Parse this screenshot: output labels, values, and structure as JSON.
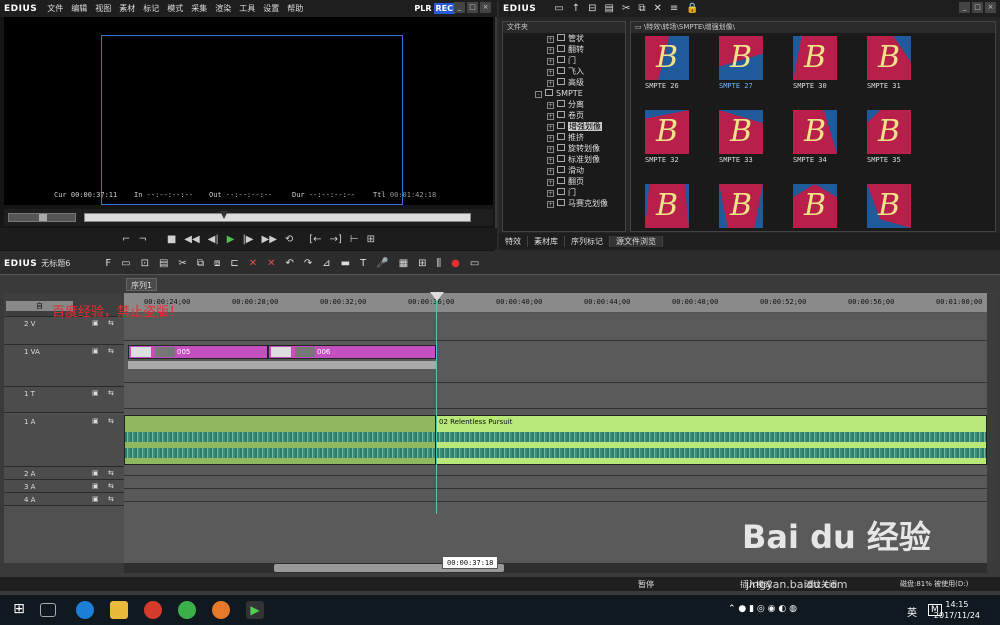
{
  "player": {
    "logo": "EDIUS",
    "menu": [
      "文件",
      "编辑",
      "视图",
      "素材",
      "标记",
      "模式",
      "采集",
      "渲染",
      "工具",
      "设置",
      "帮助"
    ],
    "plr": "PLR",
    "rec": "REC",
    "timecode": {
      "cur_label": "Cur",
      "cur": "00:00:37:11",
      "in_label": "In",
      "in": "--:--:--:--",
      "out_label": "Out",
      "out": "--:--:--:--",
      "dur_label": "Dur",
      "dur": "--:--:--:--",
      "ttl_label": "Ttl",
      "ttl": "00:01:42:18"
    },
    "scrub_position": 0.36
  },
  "bin": {
    "logo": "EDIUS",
    "tree_header": "文件夹",
    "path": "\\特效\\转场\\SMPTE\\增强划像\\",
    "tree": [
      {
        "label": "管状",
        "indent": 1,
        "box": "+"
      },
      {
        "label": "翻转",
        "indent": 1,
        "box": "+"
      },
      {
        "label": "门",
        "indent": 1,
        "box": "+"
      },
      {
        "label": "飞入",
        "indent": 1,
        "box": "+"
      },
      {
        "label": "高级",
        "indent": 1,
        "box": "+"
      },
      {
        "label": "SMPTE",
        "indent": 0,
        "box": "-"
      },
      {
        "label": "分离",
        "indent": 1,
        "box": "+"
      },
      {
        "label": "卷页",
        "indent": 1,
        "box": "+"
      },
      {
        "label": "增强划像",
        "indent": 1,
        "box": "+",
        "selected": true
      },
      {
        "label": "推挤",
        "indent": 1,
        "box": "+"
      },
      {
        "label": "旋转划像",
        "indent": 1,
        "box": "+"
      },
      {
        "label": "标准划像",
        "indent": 1,
        "box": "+"
      },
      {
        "label": "滑动",
        "indent": 1,
        "box": "+"
      },
      {
        "label": "翻页",
        "indent": 1,
        "box": "+"
      },
      {
        "label": "门",
        "indent": 1,
        "box": "+"
      },
      {
        "label": "马赛克划像",
        "indent": 1,
        "box": "+"
      }
    ],
    "thumbs": [
      {
        "label": "SMPTE  26",
        "selected": false
      },
      {
        "label": "SMPTE  27",
        "selected": true
      },
      {
        "label": "SMPTE  30",
        "selected": false
      },
      {
        "label": "SMPTE  31",
        "selected": false
      },
      {
        "label": "SMPTE  32",
        "selected": false
      },
      {
        "label": "SMPTE  33",
        "selected": false
      },
      {
        "label": "SMPTE  34",
        "selected": false
      },
      {
        "label": "SMPTE  35",
        "selected": false
      },
      {
        "label": "",
        "selected": false
      },
      {
        "label": "",
        "selected": false
      },
      {
        "label": "",
        "selected": false
      },
      {
        "label": "",
        "selected": false
      }
    ],
    "thumb_letter": "B",
    "tabs": [
      "特效",
      "素材库",
      "序列标记",
      "源文件浏览"
    ]
  },
  "timeline": {
    "logo": "EDIUS",
    "project": "无标题6",
    "sequence_tab": "序列1",
    "ruler": [
      "00:00:24;00",
      "00:00:28;00",
      "00:00:32;00",
      "00:00:36;00",
      "00:00:40;00",
      "00:00:44;00",
      "00:00:48;00",
      "00:00:52;00",
      "00:00:56;00",
      "00:01:00;00"
    ],
    "auto_label": "自",
    "tracks": [
      {
        "name": "2 V"
      },
      {
        "name": "1 VA"
      },
      {
        "name": "1 T"
      },
      {
        "name": "1 A"
      },
      {
        "name": "2 A"
      },
      {
        "name": "3 A"
      },
      {
        "name": "4 A"
      }
    ],
    "video_clips": [
      {
        "label": "005"
      },
      {
        "label": "006"
      }
    ],
    "audio_clip_title": "02 Relentless Pursuit",
    "tooltip": "00:00:37:18",
    "status": {
      "pause": "暂停",
      "insert": "插入模式",
      "ripple": "波纹关闭",
      "disk": "磁盘:81% 被使用(D:)"
    }
  },
  "overlay_text": "百度经验，禁止盗版！",
  "watermark": "Bai du 经验",
  "watermark_url": "jingyan.baidu.com",
  "taskbar": {
    "lang": "英",
    "time": "14:15",
    "date": "2017/11/24"
  },
  "colors": {
    "accent_blue": "#3b6fd8",
    "clip_magenta": "#c44fbe",
    "audio_green": "#5ca38c",
    "playhead": "#51c6b6",
    "rec_bg": "#2a5bd6"
  }
}
